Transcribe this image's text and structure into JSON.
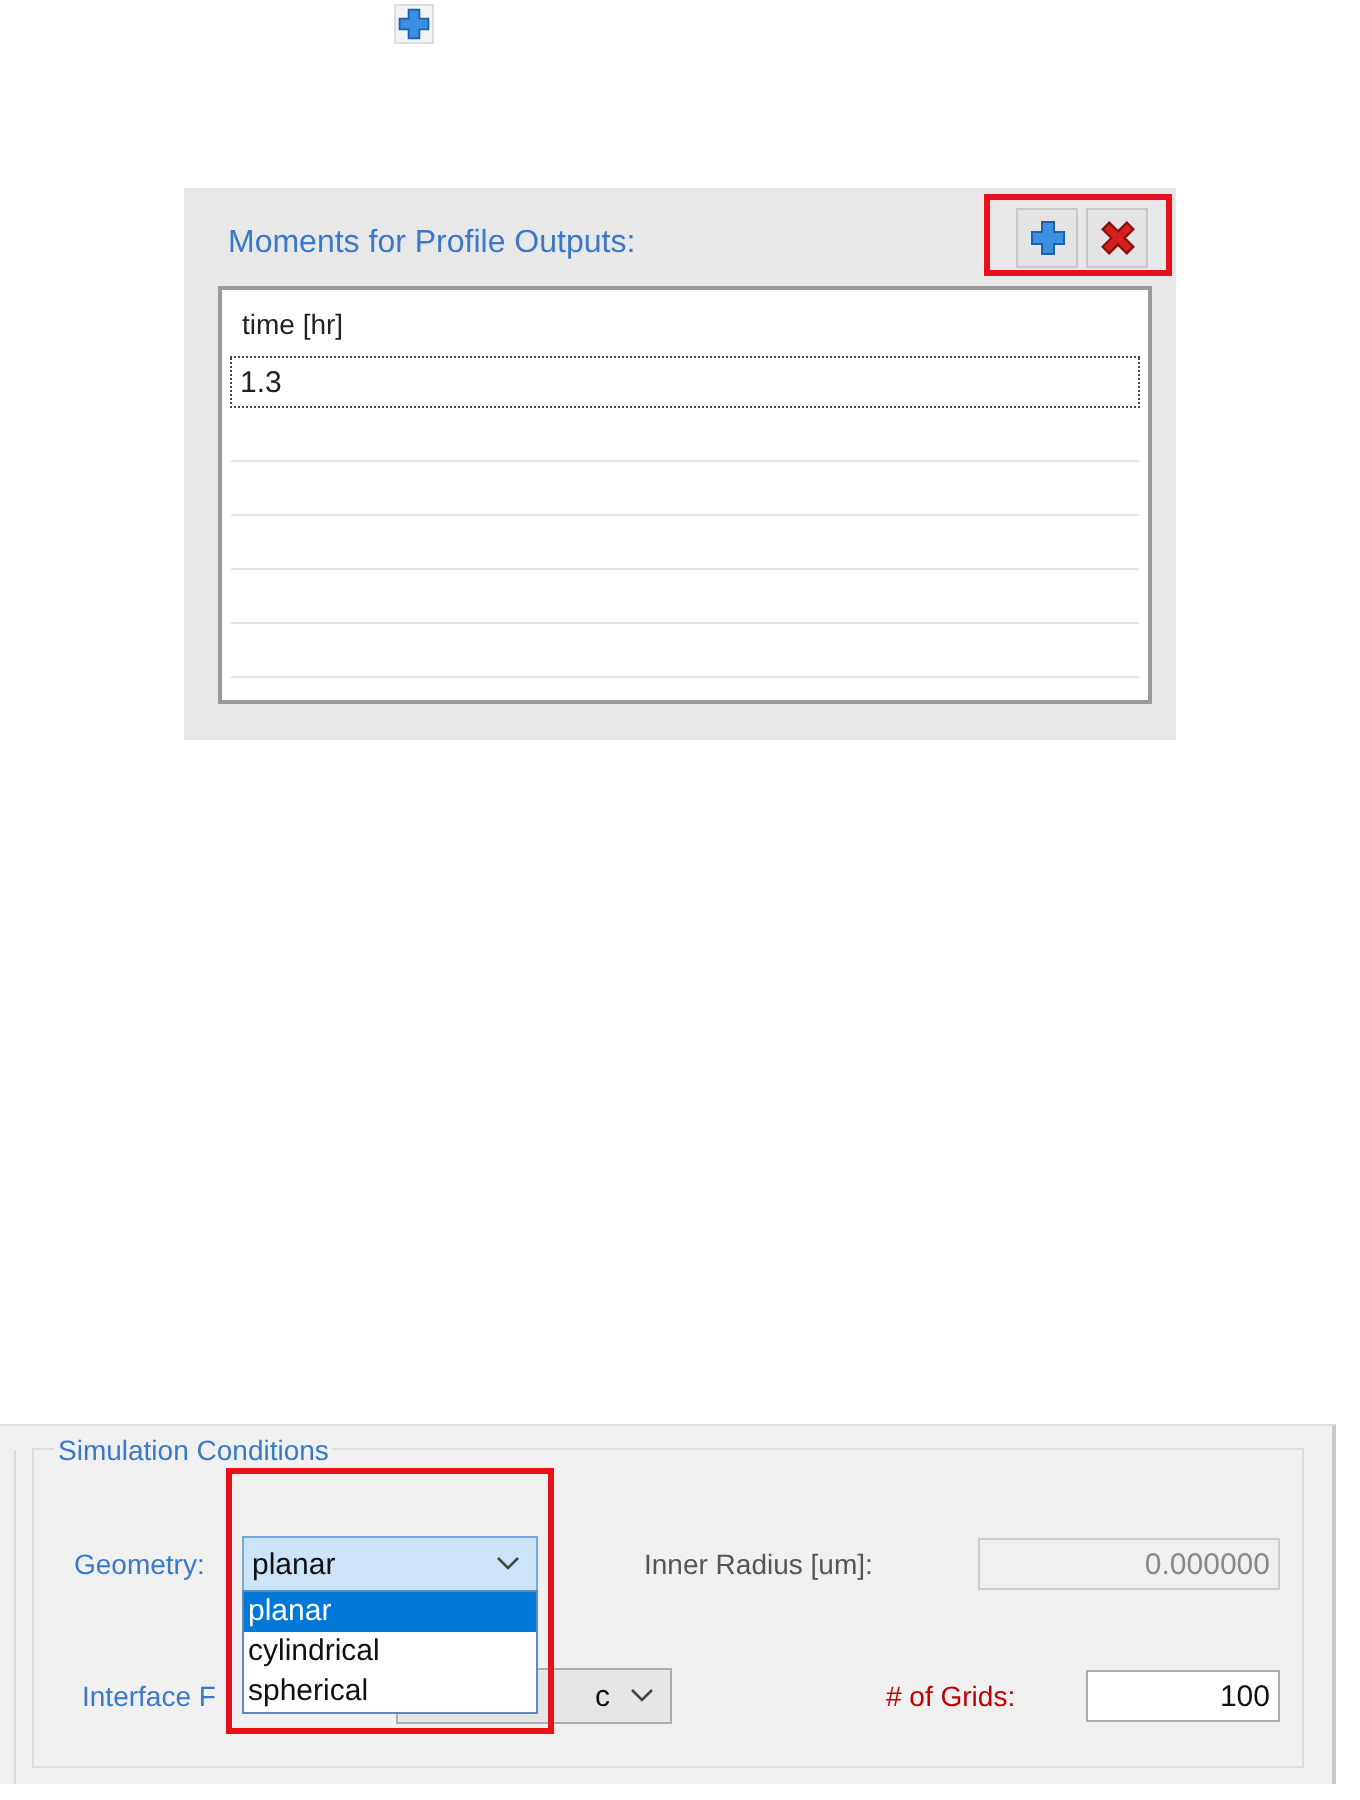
{
  "moments_panel": {
    "title": "Moments for Profile Outputs:",
    "toolbar_highlighted": true,
    "table": {
      "columns": [
        "time [hr]"
      ],
      "rows": [
        {
          "cells": [
            "1.3"
          ],
          "focused": true
        }
      ]
    }
  },
  "simulation_conditions": {
    "title": "Simulation Conditions",
    "geometry": {
      "label": "Geometry:",
      "value": "planar",
      "expanded": true,
      "highlighted": true,
      "options": [
        {
          "label": "planar",
          "selected": true
        },
        {
          "label": "cylindrical",
          "selected": false
        },
        {
          "label": "spherical",
          "selected": false
        }
      ]
    },
    "inner_radius": {
      "label": "Inner Radius [um]:",
      "value": "0.000000",
      "disabled": true
    },
    "interface": {
      "label": "Interface F",
      "value": "c"
    },
    "grids": {
      "label": "# of Grids:",
      "value": "100",
      "emphasized": true
    }
  }
}
